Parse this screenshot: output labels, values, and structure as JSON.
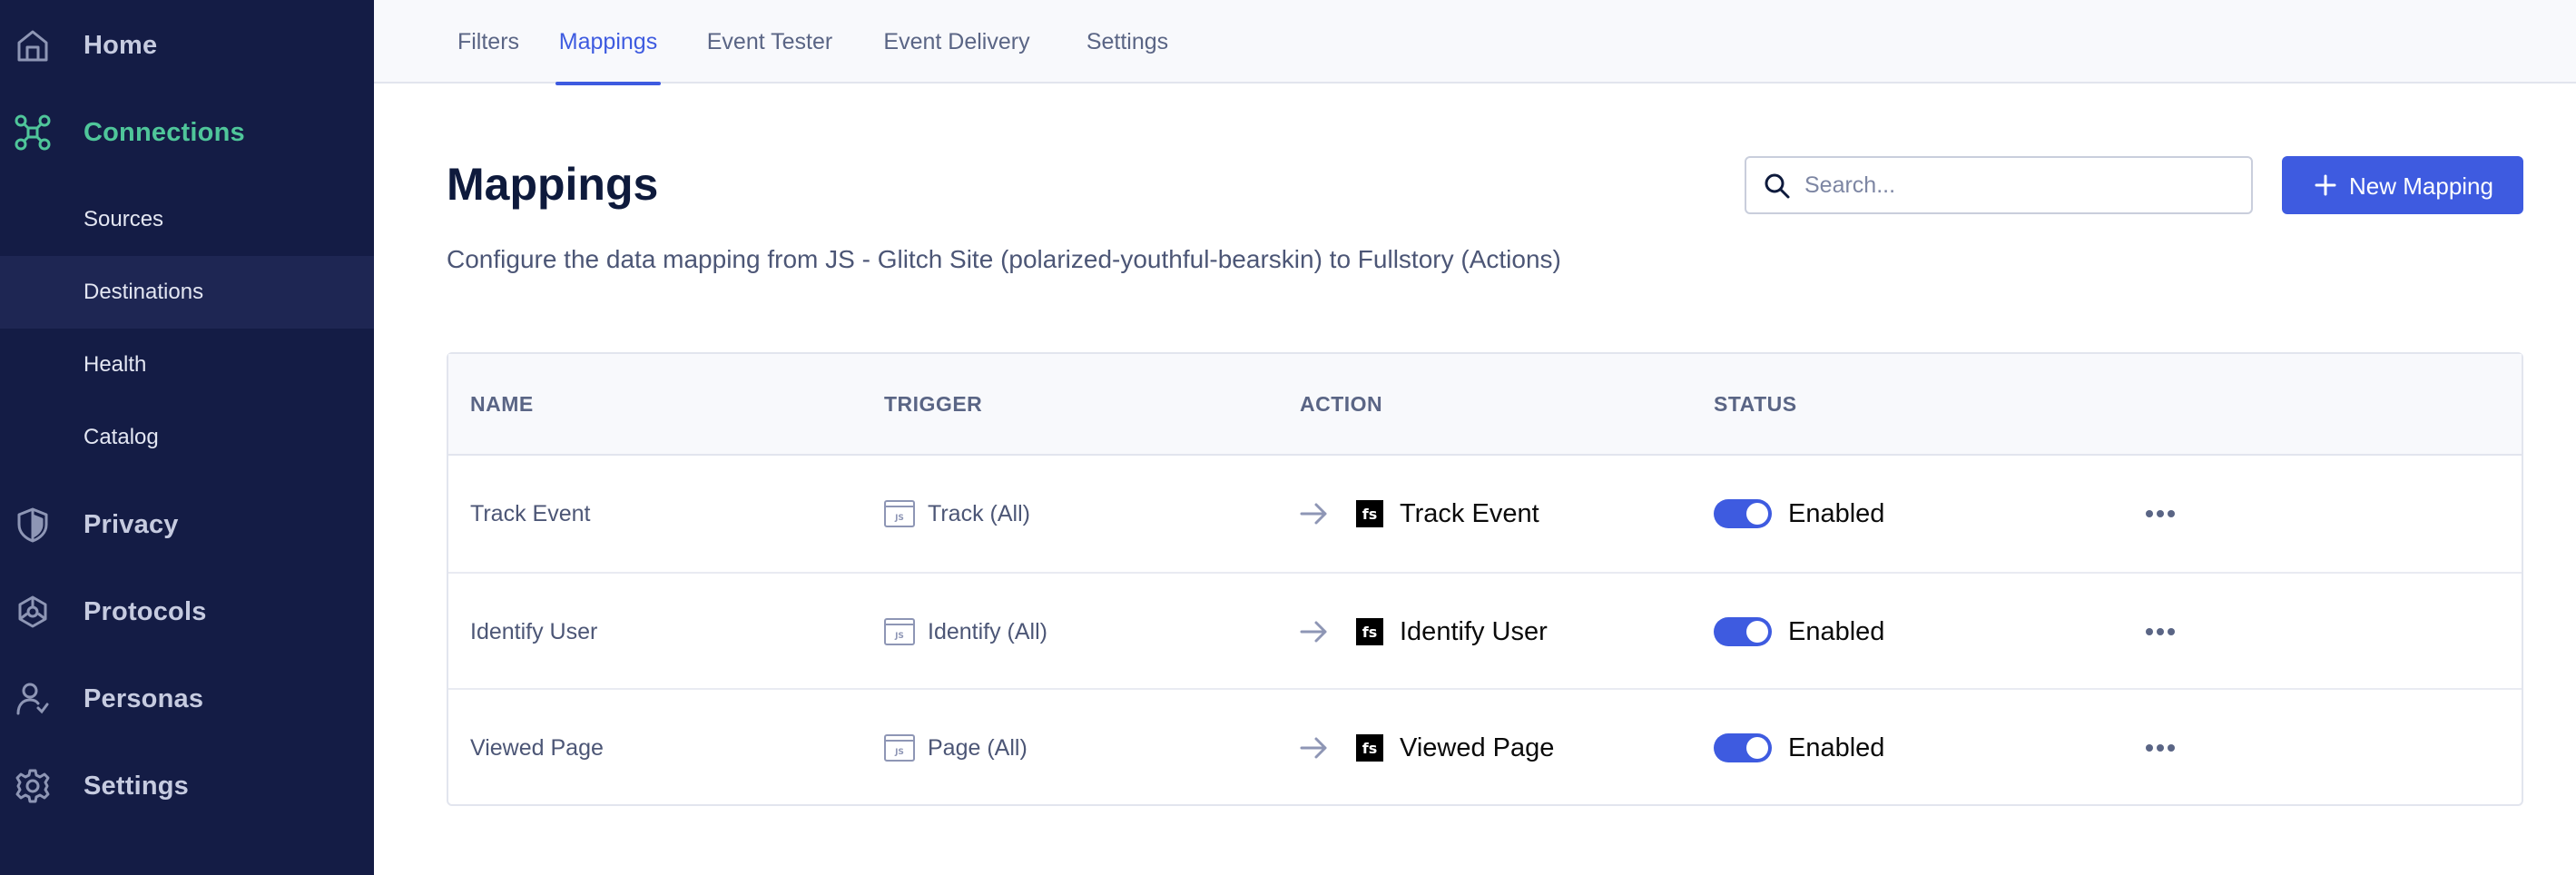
{
  "sidebar": {
    "items": [
      {
        "label": "Home",
        "icon": "home-icon"
      },
      {
        "label": "Connections",
        "icon": "connections-icon"
      },
      {
        "label": "Privacy",
        "icon": "shield-icon"
      },
      {
        "label": "Protocols",
        "icon": "protocols-icon"
      },
      {
        "label": "Personas",
        "icon": "personas-icon"
      },
      {
        "label": "Settings",
        "icon": "gear-icon"
      }
    ],
    "sub_items": [
      {
        "label": "Sources"
      },
      {
        "label": "Destinations"
      },
      {
        "label": "Health"
      },
      {
        "label": "Catalog"
      }
    ],
    "active_color": "#4fc69a",
    "background": "#141c45"
  },
  "tabs": [
    {
      "label": "Filters"
    },
    {
      "label": "Mappings"
    },
    {
      "label": "Event Tester"
    },
    {
      "label": "Event Delivery"
    },
    {
      "label": "Settings"
    }
  ],
  "header": {
    "title": "Mappings",
    "subtitle": "Configure the data mapping from JS - Glitch Site (polarized-youthful-bearskin) to Fullstory (Actions)",
    "search_placeholder": "Search...",
    "new_button_label": "New Mapping"
  },
  "table": {
    "columns": [
      "NAME",
      "TRIGGER",
      "ACTION",
      "STATUS"
    ],
    "rows": [
      {
        "name": "Track Event",
        "trigger": "Track (All)",
        "action": "Track Event",
        "status": "Enabled"
      },
      {
        "name": "Identify User",
        "trigger": "Identify (All)",
        "action": "Identify User",
        "status": "Enabled"
      },
      {
        "name": "Viewed Page",
        "trigger": "Page (All)",
        "action": "Viewed Page",
        "status": "Enabled"
      }
    ]
  },
  "accent_color": "#3e5be0",
  "fs_badge": "fs"
}
